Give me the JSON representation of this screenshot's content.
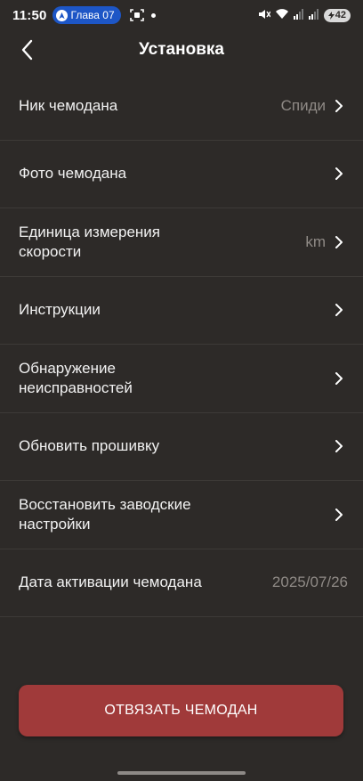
{
  "status_bar": {
    "time": "11:50",
    "nav_label": "Глава 07",
    "battery": "42"
  },
  "header": {
    "title": "Установка"
  },
  "settings": [
    {
      "label": "Ник чемодана",
      "value": "Спиди"
    },
    {
      "label": "Фото чемодана",
      "value": ""
    },
    {
      "label": "Единица измерения скорости",
      "value": "km"
    },
    {
      "label": "Инструкции",
      "value": ""
    },
    {
      "label": "Обнаружение неисправностей",
      "value": ""
    },
    {
      "label": "Обновить прошивку",
      "value": ""
    },
    {
      "label": "Восстановить заводские настройки",
      "value": ""
    },
    {
      "label": "Дата активации чемодана",
      "value": "2025/07/26"
    }
  ],
  "actions": {
    "unbind_label": "ОТВЯЗАТЬ ЧЕМОДАН"
  },
  "colors": {
    "background": "#2d2a28",
    "button": "#a03a3a",
    "muted_text": "#8f8a86",
    "nav_pill": "#1d56c6"
  }
}
